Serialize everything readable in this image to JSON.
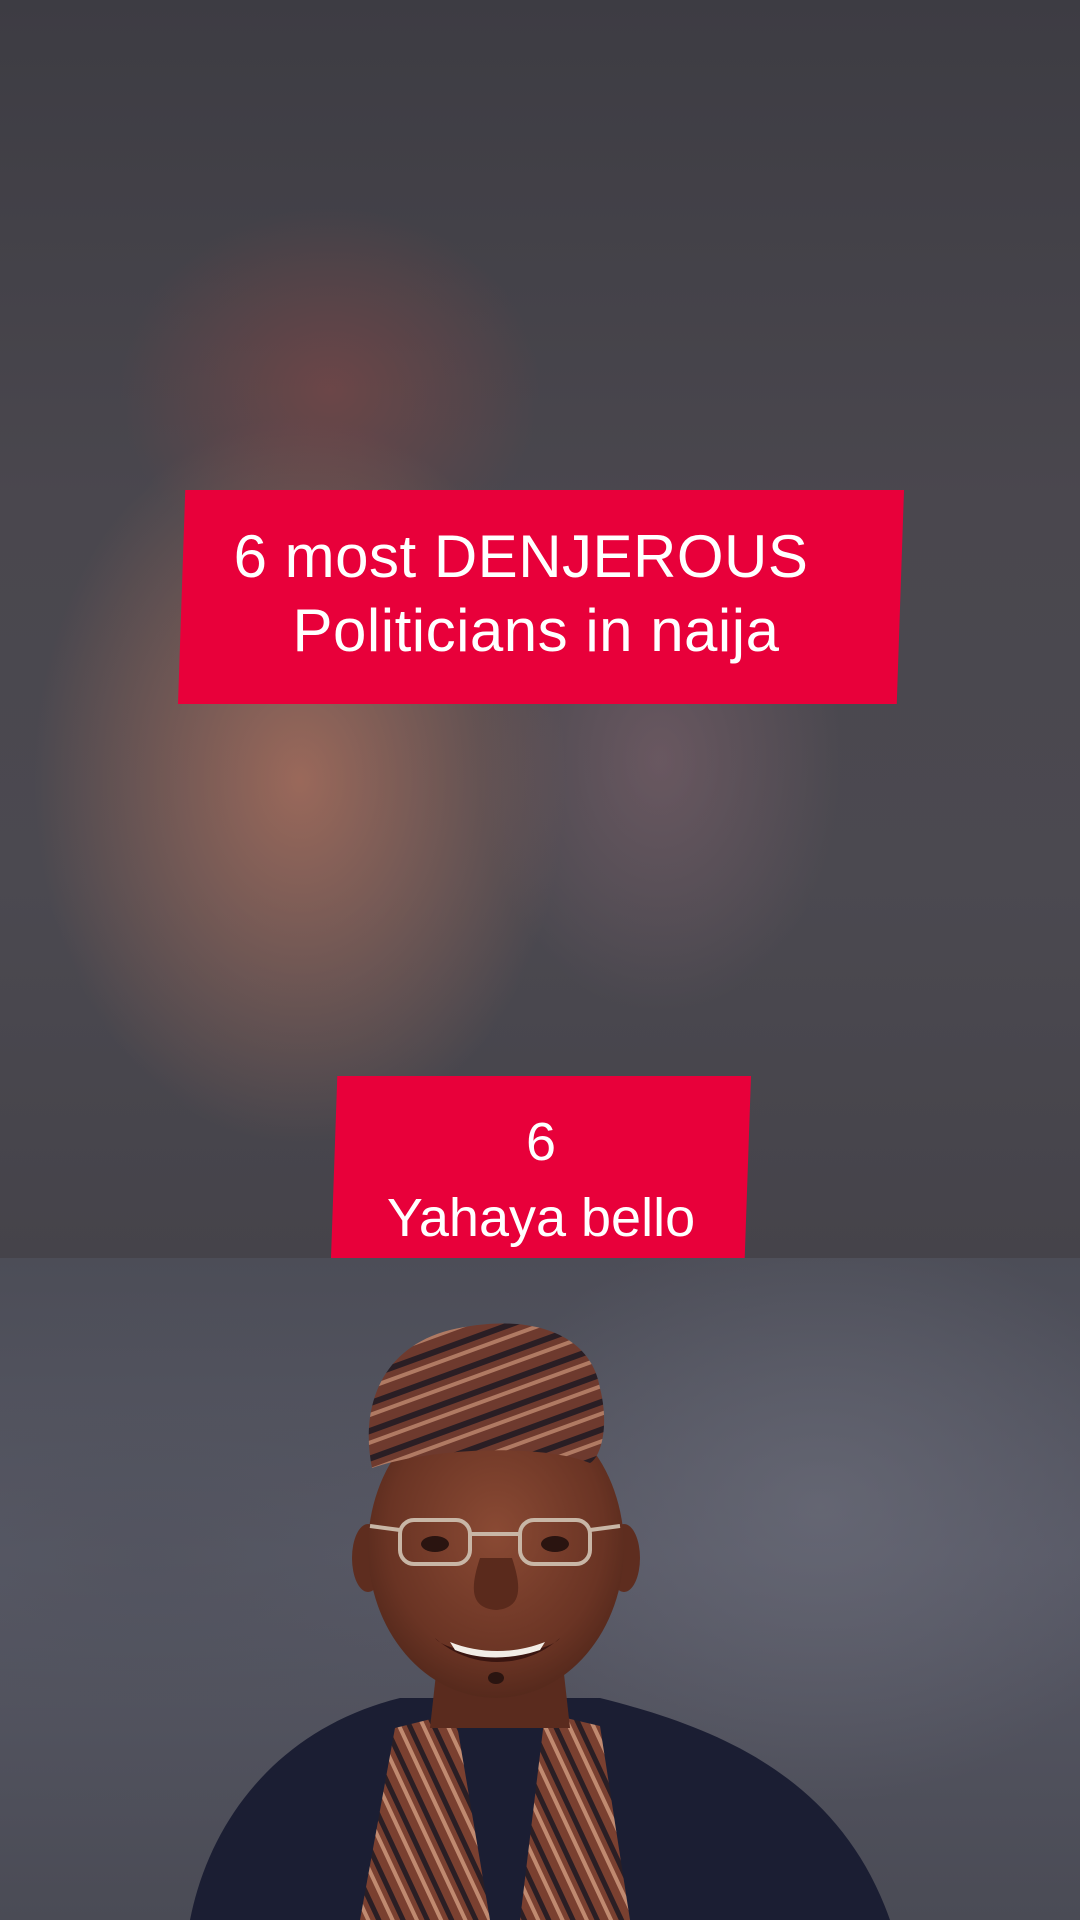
{
  "overlay": {
    "title_line1": "6 most DENJEROUS",
    "title_line2": "Politicians in naija",
    "rank": "6",
    "name": "Yahaya bello"
  },
  "colors": {
    "caption_bg": "#e8003a",
    "caption_text": "#ffffff"
  },
  "photo": {
    "subject": "man-in-striped-cap-and-glasses-smiling"
  }
}
